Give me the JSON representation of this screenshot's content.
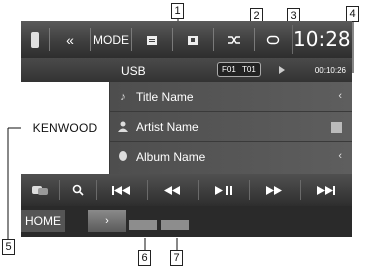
{
  "topbar": {
    "phone_icon": "phone-icon",
    "back_label": "«",
    "mode_label": "MODE",
    "folder_list_icon": "folder-list-icon",
    "folder_icon": "folder-icon",
    "shuffle_icon": "shuffle-icon",
    "repeat_icon": "repeat-icon",
    "clock": "10:28"
  },
  "info": {
    "source": "USB",
    "folder": "F01",
    "track": "T01",
    "play_time": "00:10:26"
  },
  "artwork": {
    "brand": "KENWOOD"
  },
  "tags": [
    {
      "icon": "music-note-icon",
      "label": "Title Name",
      "ctrl": "‹"
    },
    {
      "icon": "person-icon",
      "label": "Artist Name",
      "ctrl": ""
    },
    {
      "icon": "disc-icon",
      "label": "Album Name",
      "ctrl": "‹"
    }
  ],
  "controls": [
    {
      "name": "list-switch-icon",
      "glyph": "⇄"
    },
    {
      "name": "search-icon",
      "glyph": ""
    },
    {
      "name": "prev-track-icon",
      "glyph": "|◀◀"
    },
    {
      "name": "rewind-icon",
      "glyph": "◀◀"
    },
    {
      "name": "play-pause-icon",
      "glyph": "▶||"
    },
    {
      "name": "fast-forward-icon",
      "glyph": "▶▶"
    },
    {
      "name": "next-track-icon",
      "glyph": "▶▶|"
    }
  ],
  "bottom": {
    "home_label": "HOME",
    "arrow_label": "›"
  },
  "callouts": [
    "1",
    "2",
    "3",
    "4",
    "5",
    "6",
    "7"
  ],
  "colors": {
    "screen_bg": "#3a3a3a",
    "bar_dark": "#2a2a2a",
    "text": "#ffffff"
  }
}
